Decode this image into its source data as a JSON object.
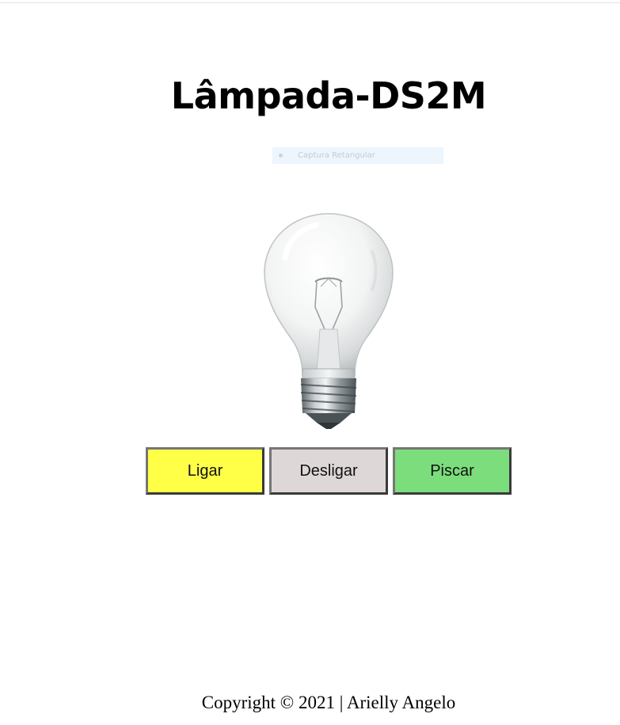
{
  "page": {
    "title": "Lâmpada-DS2M"
  },
  "overlay": {
    "capture_label": "Captura Retangular"
  },
  "lamp": {
    "state": "off",
    "icon": "light-bulb-icon"
  },
  "controls": {
    "on_label": "Ligar",
    "off_label": "Desligar",
    "blink_label": "Piscar",
    "on_color": "#ffff47",
    "off_color": "#ddd7d7",
    "blink_color": "#7cdd7c"
  },
  "footer": {
    "text": "Copyright © 2021 | Arielly Angelo"
  }
}
